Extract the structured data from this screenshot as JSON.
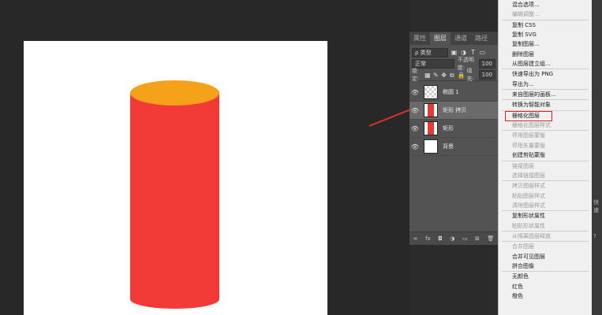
{
  "colors": {
    "cylinder_body": "#f23b36",
    "cylinder_top": "#f5a11a",
    "highlight_box": "#e02020",
    "arrow": "#e0302a"
  },
  "layers_panel": {
    "tabs": [
      "属性",
      "图层",
      "通道",
      "路径"
    ],
    "active_tab": "图层",
    "filter_label": "ρ 类型",
    "blend_mode": "正常",
    "opacity_label": "不透明度:",
    "opacity_value": "100",
    "lock_label": "锁定:",
    "fill_label": "填充:",
    "fill_value": "100",
    "layers": [
      {
        "name": "椭圆 1",
        "thumb": "checker",
        "selected": false
      },
      {
        "name": "矩形 拷贝",
        "thumb": "red",
        "selected": true
      },
      {
        "name": "矩形",
        "thumb": "red",
        "selected": false
      },
      {
        "name": "背景",
        "thumb": "white",
        "selected": false
      }
    ],
    "bottom_icons": [
      "链接",
      "fx",
      "蒙版",
      "调整",
      "组",
      "新建",
      "删除"
    ],
    "bottom_glyphs": [
      "∞",
      "fx",
      "◘",
      "◑",
      "▭",
      "⊞",
      "🗑"
    ]
  },
  "context_menu": {
    "items": [
      {
        "label": "混合选项...",
        "disabled": false
      },
      {
        "label": "编辑调整...",
        "disabled": true
      },
      {
        "sep": true
      },
      {
        "label": "复制 CSS",
        "disabled": false
      },
      {
        "label": "复制 SVG",
        "disabled": false
      },
      {
        "label": "复制图层...",
        "disabled": false
      },
      {
        "label": "删除图层",
        "disabled": false
      },
      {
        "label": "从图层建立组...",
        "disabled": false
      },
      {
        "sep": true
      },
      {
        "label": "快速导出为 PNG",
        "disabled": false
      },
      {
        "label": "导出为...",
        "disabled": false
      },
      {
        "sep": true
      },
      {
        "label": "来自图层的画板...",
        "disabled": false
      },
      {
        "sep": true
      },
      {
        "label": "转换为智能对象",
        "disabled": false
      },
      {
        "sep": true
      },
      {
        "label": "栅格化图层",
        "disabled": false,
        "highlight": true
      },
      {
        "label": "栅格化图层样式",
        "disabled": true
      },
      {
        "sep": true
      },
      {
        "label": "停用图层蒙版",
        "disabled": true
      },
      {
        "label": "停用矢量蒙版",
        "disabled": true
      },
      {
        "label": "创建剪贴蒙版",
        "disabled": false
      },
      {
        "sep": true
      },
      {
        "label": "链接图层",
        "disabled": true
      },
      {
        "label": "选择链接图层",
        "disabled": true
      },
      {
        "sep": true
      },
      {
        "label": "拷贝图层样式",
        "disabled": true
      },
      {
        "label": "粘贴图层样式",
        "disabled": true
      },
      {
        "label": "清除图层样式",
        "disabled": true
      },
      {
        "sep": true
      },
      {
        "label": "复制形状属性",
        "disabled": false
      },
      {
        "label": "粘贴形状属性",
        "disabled": true
      },
      {
        "sep": true
      },
      {
        "label": "从隔离图层释放",
        "disabled": true
      },
      {
        "sep": true
      },
      {
        "label": "合并图层",
        "disabled": true
      },
      {
        "label": "合并可见图层",
        "disabled": false
      },
      {
        "label": "拼合图像",
        "disabled": false
      },
      {
        "sep": true
      },
      {
        "label": "无颜色",
        "disabled": false
      },
      {
        "label": "红色",
        "disabled": false
      },
      {
        "label": "橙色",
        "disabled": false
      }
    ]
  },
  "right_strip": [
    "快速",
    "?"
  ]
}
